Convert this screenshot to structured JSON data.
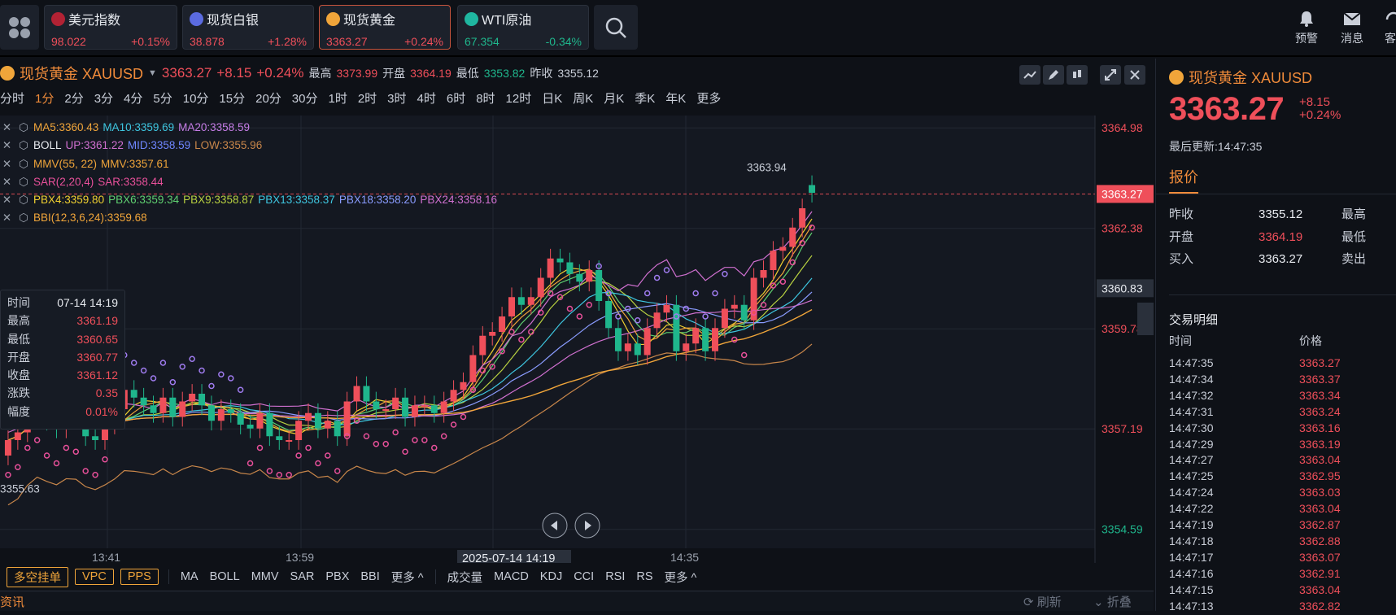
{
  "tickers": [
    {
      "name": "美元指数",
      "price": "98.022",
      "change": "+0.15%",
      "dir": "up",
      "color": "#b22234"
    },
    {
      "name": "现货白银",
      "price": "38.878",
      "change": "+1.28%",
      "dir": "up",
      "color": "#5b6be0"
    },
    {
      "name": "现货黄金",
      "price": "3363.27",
      "change": "+0.24%",
      "dir": "up",
      "color": "#f0a53a"
    },
    {
      "name": "WTI原油",
      "price": "67.354",
      "change": "-0.34%",
      "dir": "dn",
      "color": "#1fb6a0"
    }
  ],
  "tools": [
    {
      "label": "预警",
      "icon": "bell-icon"
    },
    {
      "label": "消息",
      "icon": "mail-icon"
    },
    {
      "label": "客",
      "icon": "service-icon"
    }
  ],
  "header": {
    "symbol": "现货黄金 XAUUSD",
    "price": "3363.27",
    "change": "+8.15",
    "pct": "+0.24%",
    "high_label": "最高",
    "high": "3373.99",
    "open_label": "开盘",
    "open": "3364.19",
    "low_label": "最低",
    "low": "3353.82",
    "prev_label": "昨收",
    "prev": "3355.12"
  },
  "periods": [
    "分时",
    "1分",
    "2分",
    "3分",
    "4分",
    "5分",
    "10分",
    "15分",
    "20分",
    "30分",
    "1时",
    "2时",
    "3时",
    "4时",
    "6时",
    "8时",
    "12时",
    "日K",
    "周K",
    "月K",
    "季K",
    "年K",
    "更多"
  ],
  "active_period": "1分",
  "indicators": [
    {
      "parts": [
        {
          "t": "MA5:3360.43",
          "c": "#f0a53a"
        },
        {
          "t": "MA10:3359.69",
          "c": "#3ec6e0"
        },
        {
          "t": "MA20:3358.59",
          "c": "#c77ee8"
        }
      ]
    },
    {
      "parts": [
        {
          "t": "BOLL",
          "c": "#e8ebf0"
        },
        {
          "t": "UP:3361.22",
          "c": "#d070d0"
        },
        {
          "t": "MID:3358.59",
          "c": "#6f86ff"
        },
        {
          "t": "LOW:3355.96",
          "c": "#c8864a"
        }
      ]
    },
    {
      "parts": [
        {
          "t": "MMV(55, 22)",
          "c": "#f0a53a"
        },
        {
          "t": "MMV:3357.61",
          "c": "#f0a53a"
        }
      ]
    },
    {
      "parts": [
        {
          "t": "SAR(2,20,4)",
          "c": "#e8509a"
        },
        {
          "t": "SAR:3358.44",
          "c": "#e8509a"
        }
      ]
    },
    {
      "parts": [
        {
          "t": "PBX4:3359.80",
          "c": "#f0d030"
        },
        {
          "t": "PBX6:3359.34",
          "c": "#5fd070"
        },
        {
          "t": "PBX9:3358.87",
          "c": "#b8d040"
        },
        {
          "t": "PBX13:3358.37",
          "c": "#3ec6e0"
        },
        {
          "t": "PBX18:3358.20",
          "c": "#8a9cff"
        },
        {
          "t": "PBX24:3358.16",
          "c": "#d070d0"
        }
      ]
    },
    {
      "parts": [
        {
          "t": "BBI(12,3,6,24):3359.68",
          "c": "#f0a53a"
        }
      ]
    }
  ],
  "tooltip": [
    {
      "k": "时间",
      "v": "07-14 14:19",
      "w": true
    },
    {
      "k": "最高",
      "v": "3361.19"
    },
    {
      "k": "最低",
      "v": "3360.65"
    },
    {
      "k": "开盘",
      "v": "3360.77"
    },
    {
      "k": "收盘",
      "v": "3361.12"
    },
    {
      "k": "涨跌",
      "v": "0.35"
    },
    {
      "k": "幅度",
      "v": "0.01%"
    }
  ],
  "chart_data": {
    "type": "candlestick",
    "ylim": [
      3354.1,
      3365.3
    ],
    "y_ticks": [
      "3364.98",
      "3362.38",
      "3359.78",
      "3357.19",
      "3354.59"
    ],
    "y_tick_values": [
      3364.98,
      3362.38,
      3359.78,
      3357.19,
      3354.59
    ],
    "x_ticks": [
      "13:41",
      "13:59",
      "14:35"
    ],
    "crosshair_time": "2025-07-14 14:19",
    "current_price": "3363.27",
    "hover_price": "3360.83",
    "max_label": "3363.94",
    "min_label": "3355.63",
    "closes": [
      3356.9,
      3357.1,
      3357.6,
      3357.8,
      3357.4,
      3357.2,
      3357.6,
      3357.5,
      3357.0,
      3356.9,
      3357.3,
      3357.7,
      3358.2,
      3358.0,
      3357.8,
      3357.6,
      3358.0,
      3357.5,
      3357.9,
      3358.1,
      3357.8,
      3357.4,
      3357.7,
      3357.6,
      3357.3,
      3357.2,
      3357.6,
      3357.0,
      3356.9,
      3356.9,
      3357.4,
      3357.6,
      3357.2,
      3357.4,
      3357.0,
      3357.9,
      3358.3,
      3357.9,
      3357.7,
      3357.7,
      3358.0,
      3357.5,
      3357.8,
      3357.8,
      3357.6,
      3357.9,
      3358.2,
      3358.4,
      3359.1,
      3359.6,
      3359.7,
      3360.1,
      3360.6,
      3360.4,
      3360.6,
      3361.1,
      3361.6,
      3361.5,
      3361.2,
      3361.0,
      3361.3,
      3360.5,
      3359.8,
      3359.2,
      3359.4,
      3359.1,
      3359.8,
      3360.2,
      3360.4,
      3359.2,
      3359.4,
      3359.8,
      3359.2,
      3359.8,
      3360.3,
      3360.4,
      3360.0,
      3361.1,
      3361.3,
      3361.8,
      3361.9,
      3362.4,
      3362.9,
      3363.3
    ],
    "opens": [
      3356.5,
      3356.9,
      3357.1,
      3357.6,
      3357.8,
      3357.4,
      3357.2,
      3357.6,
      3357.5,
      3357.0,
      3356.9,
      3357.3,
      3357.7,
      3358.2,
      3358.0,
      3357.8,
      3357.6,
      3358.0,
      3357.5,
      3357.9,
      3358.1,
      3357.8,
      3357.4,
      3357.7,
      3357.6,
      3357.3,
      3357.2,
      3357.6,
      3357.0,
      3356.9,
      3356.9,
      3357.4,
      3357.6,
      3357.2,
      3357.4,
      3357.0,
      3357.9,
      3358.3,
      3357.9,
      3357.7,
      3357.7,
      3358.0,
      3357.5,
      3357.8,
      3357.8,
      3357.6,
      3357.9,
      3358.2,
      3358.4,
      3359.1,
      3359.6,
      3359.7,
      3360.1,
      3360.6,
      3360.4,
      3360.6,
      3361.1,
      3361.6,
      3361.5,
      3361.2,
      3361.0,
      3361.3,
      3360.5,
      3359.8,
      3359.2,
      3359.4,
      3359.1,
      3359.8,
      3360.2,
      3360.4,
      3359.2,
      3359.4,
      3359.8,
      3359.2,
      3359.8,
      3360.3,
      3360.4,
      3360.0,
      3361.1,
      3361.3,
      3361.8,
      3361.9,
      3362.4,
      3363.5
    ]
  },
  "bottom": {
    "tags": [
      "多空挂单",
      "VPC",
      "PPS"
    ],
    "main": [
      "MA",
      "BOLL",
      "MMV",
      "SAR",
      "PBX",
      "BBI",
      "更多 ^"
    ],
    "sub": [
      "成交量",
      "MACD",
      "KDJ",
      "CCI",
      "RSI",
      "RS",
      "更多 ^"
    ]
  },
  "news": {
    "title": "资讯",
    "refresh": "刷新",
    "collapse": "折叠"
  },
  "side": {
    "title": "现货黄金 XAUUSD",
    "price": "3363.27",
    "change": "+8.15",
    "pct": "+0.24%",
    "updated": "最后更新:14:47:35",
    "tab": "报价",
    "quote": [
      [
        "昨收",
        "3355.12",
        "最高"
      ],
      [
        "开盘",
        "3364.19",
        "最低"
      ],
      [
        "买入",
        "3363.27",
        "卖出"
      ]
    ],
    "trades_title": "交易明细",
    "col_time": "时间",
    "col_price": "价格",
    "trades": [
      [
        "14:47:35",
        "3363.27"
      ],
      [
        "14:47:34",
        "3363.37"
      ],
      [
        "14:47:32",
        "3363.34"
      ],
      [
        "14:47:31",
        "3363.24"
      ],
      [
        "14:47:30",
        "3363.16"
      ],
      [
        "14:47:29",
        "3363.19"
      ],
      [
        "14:47:27",
        "3363.04"
      ],
      [
        "14:47:25",
        "3362.95"
      ],
      [
        "14:47:24",
        "3363.03"
      ],
      [
        "14:47:22",
        "3363.04"
      ],
      [
        "14:47:19",
        "3362.87"
      ],
      [
        "14:47:18",
        "3362.88"
      ],
      [
        "14:47:17",
        "3363.07"
      ],
      [
        "14:47:16",
        "3362.91"
      ],
      [
        "14:47:15",
        "3363.04"
      ],
      [
        "14:47:13",
        "3362.82"
      ]
    ]
  }
}
